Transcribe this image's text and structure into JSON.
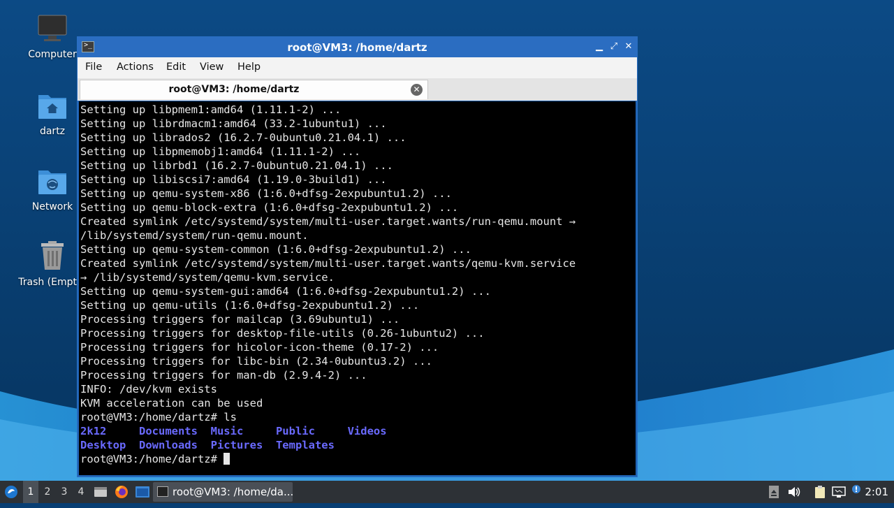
{
  "desktop": {
    "icons": [
      {
        "label": "Computer",
        "icon": "computer-icon"
      },
      {
        "label": "dartz",
        "icon": "home-folder-icon"
      },
      {
        "label": "Network",
        "icon": "network-folder-icon"
      },
      {
        "label": "Trash (Empty)",
        "icon": "trash-icon"
      }
    ]
  },
  "window": {
    "title": "root@VM3: /home/dartz",
    "controls": {
      "minimize": "▁",
      "maximize": "⤢",
      "close": "✕"
    },
    "menu": [
      "File",
      "Actions",
      "Edit",
      "View",
      "Help"
    ],
    "tab": {
      "label": "root@VM3: /home/dartz",
      "close": "✕"
    }
  },
  "terminal": {
    "lines": [
      "Setting up libpmem1:amd64 (1.11.1-2) ...",
      "Setting up librdmacm1:amd64 (33.2-1ubuntu1) ...",
      "Setting up librados2 (16.2.7-0ubuntu0.21.04.1) ...",
      "Setting up libpmemobj1:amd64 (1.11.1-2) ...",
      "Setting up librbd1 (16.2.7-0ubuntu0.21.04.1) ...",
      "Setting up libiscsi7:amd64 (1.19.0-3build1) ...",
      "Setting up qemu-system-x86 (1:6.0+dfsg-2expubuntu1.2) ...",
      "Setting up qemu-block-extra (1:6.0+dfsg-2expubuntu1.2) ...",
      "Created symlink /etc/systemd/system/multi-user.target.wants/run-qemu.mount →",
      "/lib/systemd/system/run-qemu.mount.",
      "Setting up qemu-system-common (1:6.0+dfsg-2expubuntu1.2) ...",
      "Created symlink /etc/systemd/system/multi-user.target.wants/qemu-kvm.service",
      "→ /lib/systemd/system/qemu-kvm.service.",
      "Setting up qemu-system-gui:amd64 (1:6.0+dfsg-2expubuntu1.2) ...",
      "Setting up qemu-utils (1:6.0+dfsg-2expubuntu1.2) ...",
      "Processing triggers for mailcap (3.69ubuntu1) ...",
      "Processing triggers for desktop-file-utils (0.26-1ubuntu2) ...",
      "Processing triggers for hicolor-icon-theme (0.17-2) ...",
      "Processing triggers for libc-bin (2.34-0ubuntu3.2) ...",
      "Processing triggers for man-db (2.9.4-2) ...",
      "INFO: /dev/kvm exists",
      "KVM acceleration can be used",
      "root@VM3:/home/dartz# ls"
    ],
    "ls_rows": [
      "2k12     Documents  Music     Public     Videos",
      "Desktop  Downloads  Pictures  Templates"
    ],
    "prompt": "root@VM3:/home/dartz# ",
    "colors": {
      "background": "#000000",
      "text": "#e6e6e6",
      "directory": "#6a6aff"
    }
  },
  "taskbar": {
    "workspaces": [
      "1",
      "2",
      "3",
      "4"
    ],
    "active_workspace": "1",
    "launchers": [
      "menu-icon",
      "file-manager-icon",
      "firefox-icon",
      "terminal-launcher-icon"
    ],
    "task_label": "root@VM3: /home/da...",
    "tray": [
      "removable-media-icon",
      "volume-icon",
      "clipboard-icon",
      "network-tray-icon",
      "update-notifier-icon"
    ],
    "clock": "2:01"
  }
}
